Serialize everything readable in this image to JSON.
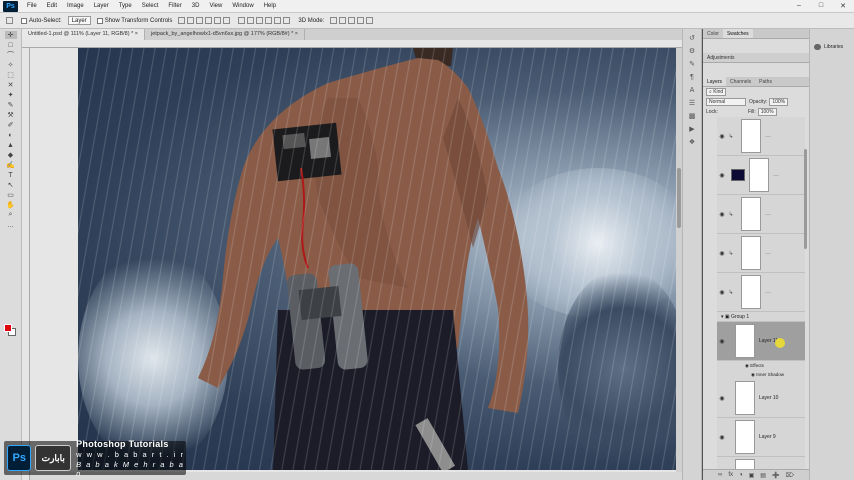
{
  "app": {
    "logo": "Ps"
  },
  "menu": [
    "File",
    "Edit",
    "Image",
    "Layer",
    "Type",
    "Select",
    "Filter",
    "3D",
    "View",
    "Window",
    "Help"
  ],
  "window_controls": [
    "–",
    "□",
    "✕"
  ],
  "options_bar": {
    "auto_select_label": "Auto-Select:",
    "auto_select_value": "Layer",
    "show_transform_label": "Show Transform Controls",
    "mode_3d": "3D Mode:"
  },
  "doc_tabs": [
    {
      "label": "Untitled-1.psd @ 111% (Layer 11, RGB/8) *",
      "close": "×"
    },
    {
      "label": "jetpack_by_angelhowlx1-d5vn6sx.jpg @ 177% (RGB/8#) *",
      "close": "×"
    }
  ],
  "tools": [
    "✛",
    "□",
    "⌒",
    "✧",
    "⬚",
    "✕",
    "✦",
    "✎",
    "⚒",
    "✐",
    "◐",
    "▲",
    "◆",
    "✍",
    "T",
    "↖",
    "▭",
    "✋",
    "⌕",
    "…"
  ],
  "panels": {
    "top_tabs": [
      "Color",
      "Swatches"
    ],
    "adjustments": "Adjustments",
    "layers_tabs": [
      "Layers",
      "Channels",
      "Paths"
    ],
    "filter_kind": "⌕ Kind",
    "blend_mode": "Normal",
    "opacity_label": "Opacity:",
    "opacity_value": "100%",
    "lock_label": "Lock:",
    "fill_label": "Fill:",
    "fill_value": "100%",
    "group_name": "Group 1",
    "selected_layer": "Layer 11",
    "effects_label": "Effects",
    "inner_shadow": "Inner Shadow",
    "layer_10": "Layer 10",
    "layer_9": "Layer 9",
    "footer_icons": [
      "∞",
      "fx",
      "◑",
      "▣",
      "▤",
      "➕",
      "⌦"
    ]
  },
  "libraries": "Libraries",
  "watermark": {
    "ps": "Ps",
    "logo": "بابارت",
    "title": "Photoshop Tutorials",
    "url": "w w w . b a b a r t . i r",
    "author": "B a b a k   M e h r a b a n"
  }
}
